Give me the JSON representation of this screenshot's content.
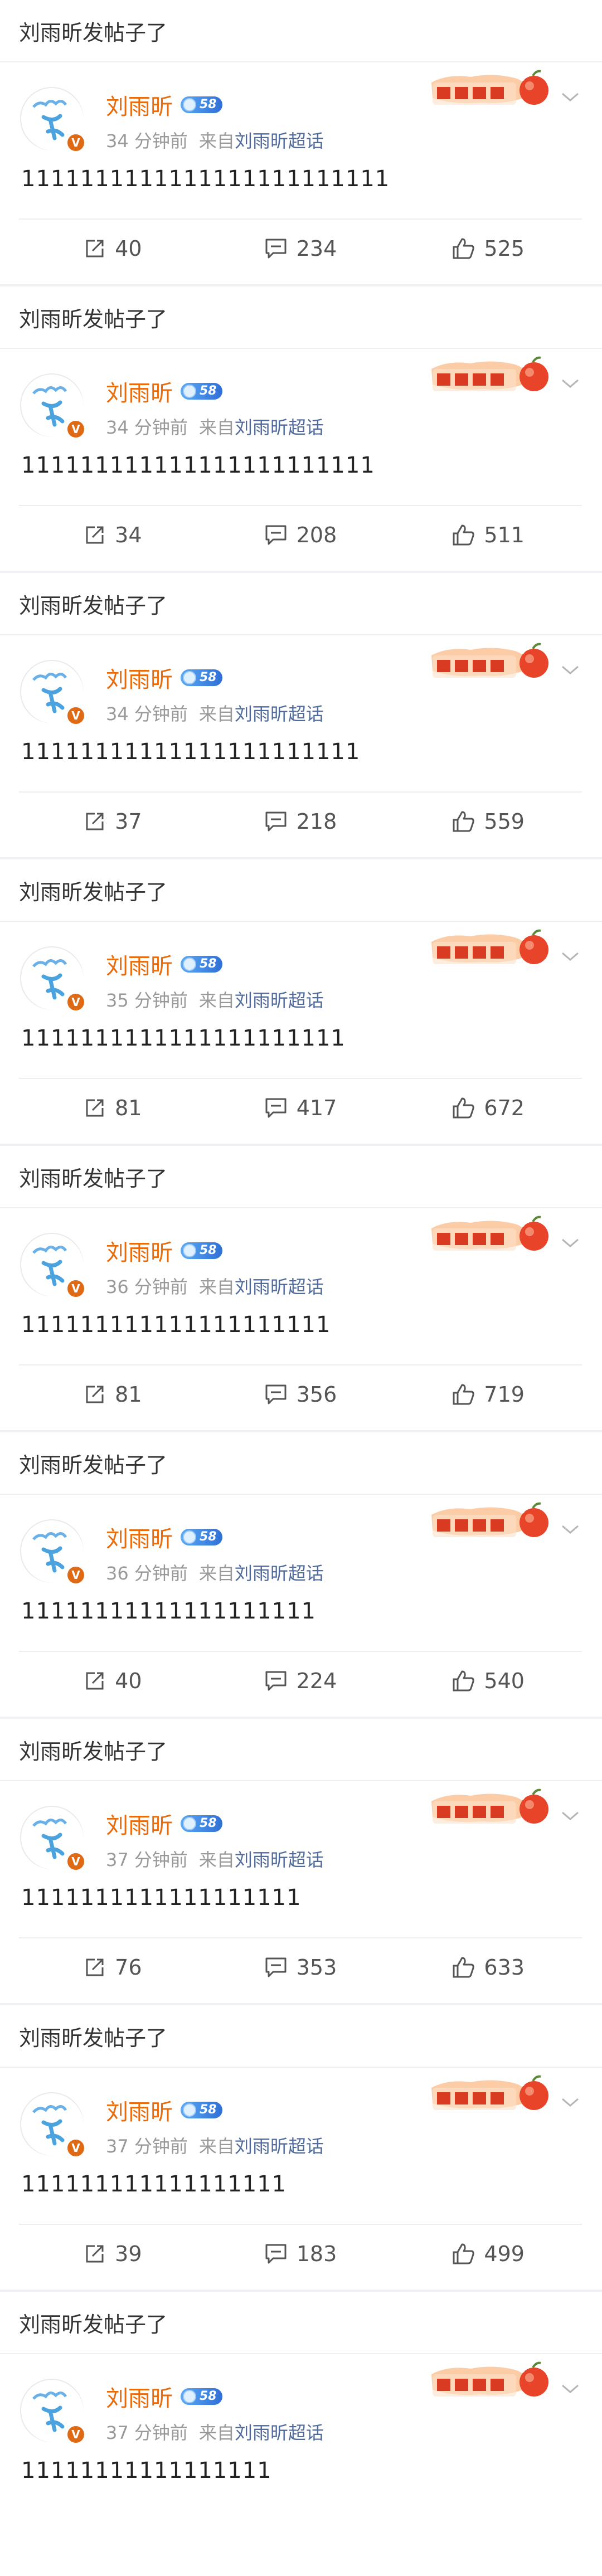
{
  "header_text": "刘雨昕发帖子了",
  "username": "刘雨昕",
  "level": "58",
  "verified_badge": "V",
  "source_prefix": "来自",
  "topic": "刘雨昕超话",
  "brand_color": "#e86b0c",
  "icons": {
    "repost": "repost-icon",
    "comment": "comment-icon",
    "like": "like-icon",
    "more": "chevron-down-icon"
  },
  "posts": [
    {
      "time": "34 分钟前",
      "content": "1111111111111111111111111",
      "reposts": "40",
      "comments": "234",
      "likes": "525"
    },
    {
      "time": "34 分钟前",
      "content": "111111111111111111111111",
      "reposts": "34",
      "comments": "208",
      "likes": "511"
    },
    {
      "time": "34 分钟前",
      "content": "11111111111111111111111",
      "reposts": "37",
      "comments": "218",
      "likes": "559"
    },
    {
      "time": "35 分钟前",
      "content": "1111111111111111111111",
      "reposts": "81",
      "comments": "417",
      "likes": "672"
    },
    {
      "time": "36 分钟前",
      "content": "111111111111111111111",
      "reposts": "81",
      "comments": "356",
      "likes": "719"
    },
    {
      "time": "36 分钟前",
      "content": "11111111111111111111",
      "reposts": "40",
      "comments": "224",
      "likes": "540"
    },
    {
      "time": "37 分钟前",
      "content": "1111111111111111111",
      "reposts": "76",
      "comments": "353",
      "likes": "633"
    },
    {
      "time": "37 分钟前",
      "content": "111111111111111111",
      "reposts": "39",
      "comments": "183",
      "likes": "499"
    },
    {
      "time": "37 分钟前",
      "content": "11111111111111111",
      "reposts": null,
      "comments": null,
      "likes": null
    }
  ]
}
